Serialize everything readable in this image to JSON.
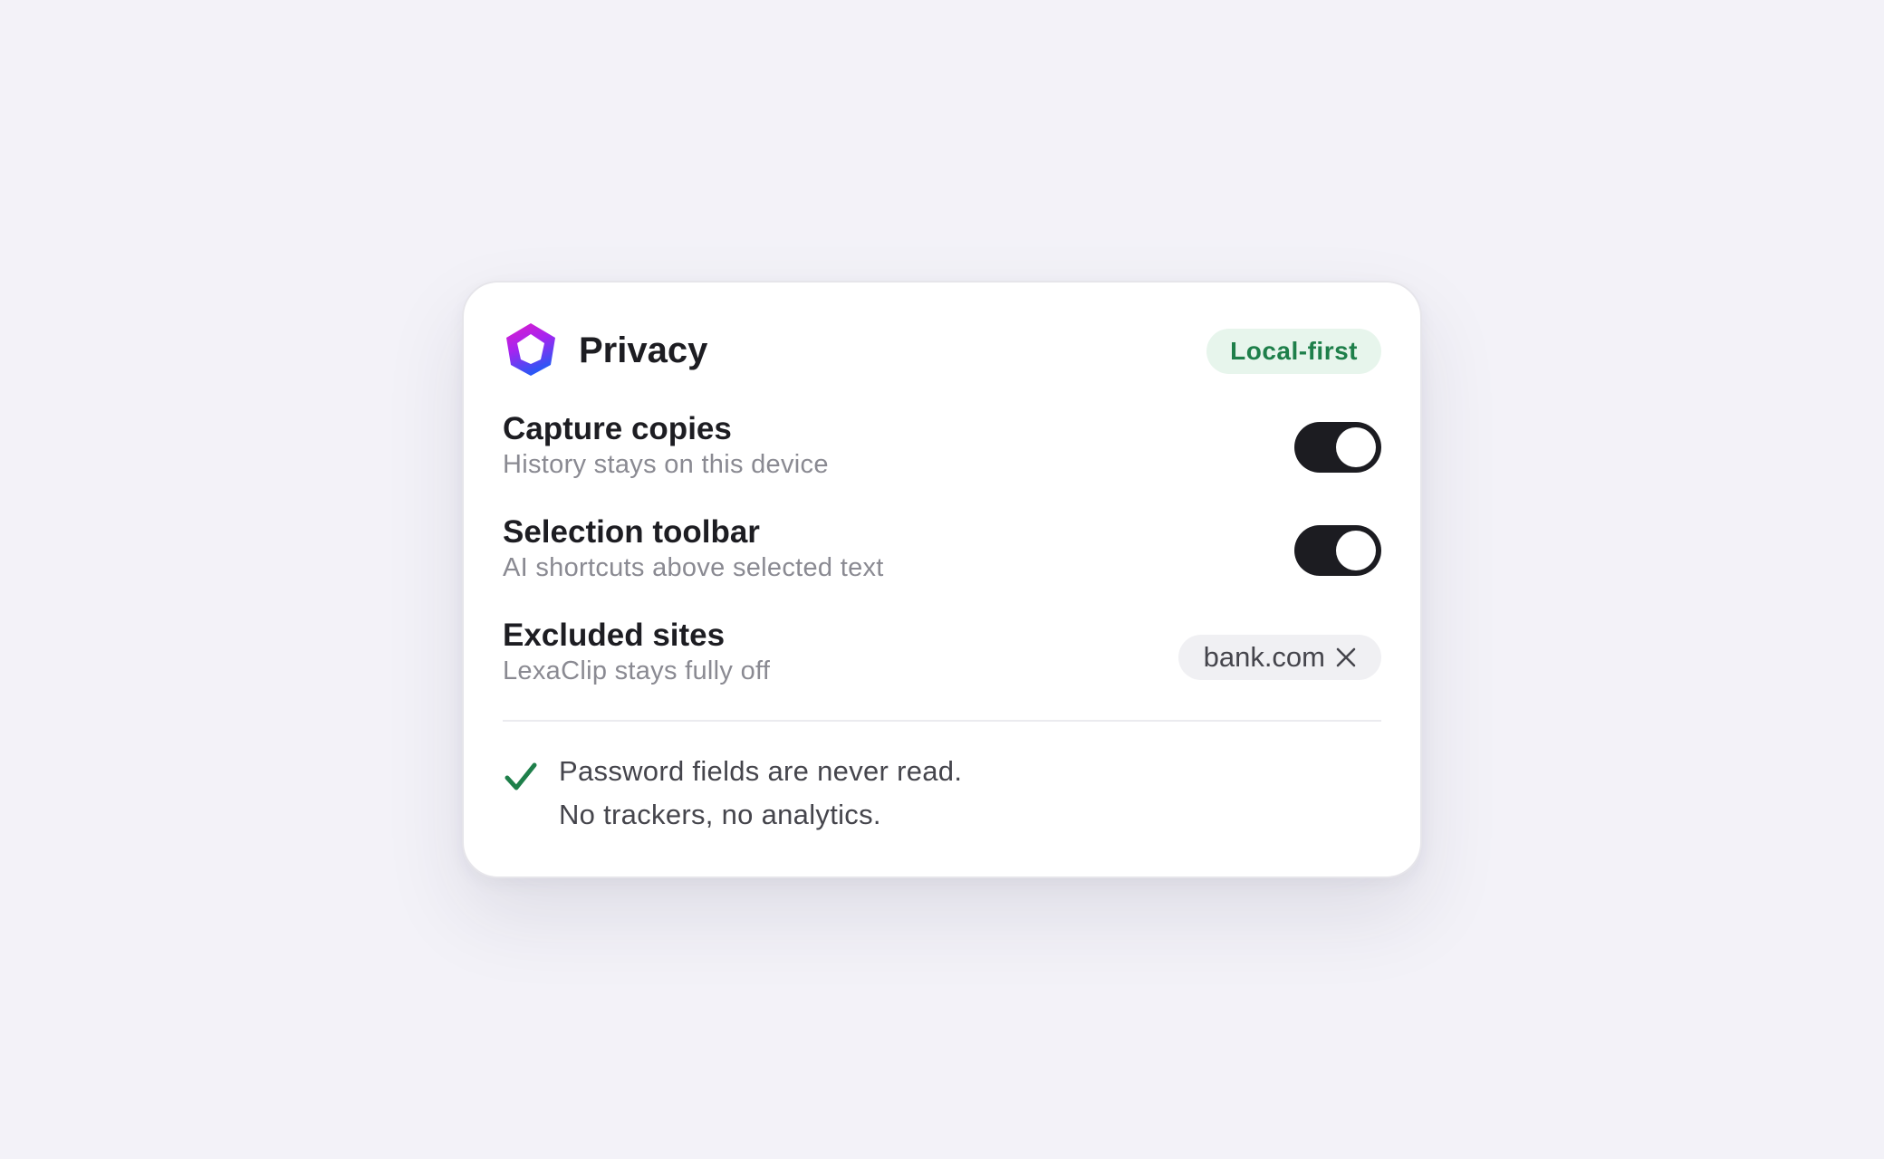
{
  "panel": {
    "logo_icon": "lexaclip-logo-icon",
    "title": "Privacy",
    "badge": "Local-first",
    "badge_color": "#1e7f4a"
  },
  "settings": [
    {
      "label": "Capture copies",
      "description": "History stays on this device",
      "control": "toggle",
      "enabled": true
    },
    {
      "label": "Selection toolbar",
      "description": "AI shortcuts above selected text",
      "control": "toggle",
      "enabled": true
    },
    {
      "label": "Excluded sites",
      "description": "LexaClip stays fully off",
      "control": "chip",
      "sites": [
        "bank.com"
      ],
      "remove_icon": "close-icon"
    }
  ],
  "footer_note": {
    "icon": "checkmark-icon",
    "icon_color": "#1e7f4a",
    "lines": [
      "Password fields are never read.",
      "No trackers, no analytics."
    ]
  }
}
